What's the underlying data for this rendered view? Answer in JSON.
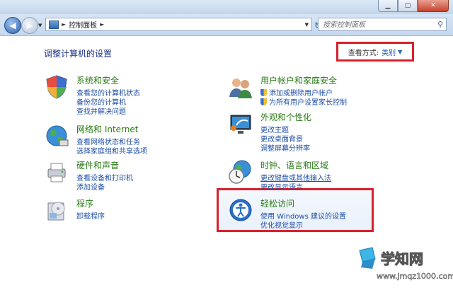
{
  "window": {
    "minimize_glyph": "▁",
    "maximize_glyph": "▢",
    "close_glyph": "✕"
  },
  "address": {
    "crumb": "控制面板",
    "separator": "►",
    "dropdown_glyph": "▼"
  },
  "search": {
    "placeholder": "搜索控制面板",
    "icon": "search-icon"
  },
  "page": {
    "title": "调整计算机的设置",
    "view_by_label": "查看方式:",
    "view_by_value": "类别",
    "view_by_arrow": "▼"
  },
  "categories": [
    {
      "title": "系统和安全",
      "icon": "shield-icon",
      "links": [
        "查看您的计算机状态",
        "备份您的计算机",
        "查找并解决问题"
      ]
    },
    {
      "title": "网络和 Internet",
      "icon": "network-globe-icon",
      "links": [
        "查看网络状态和任务",
        "选择家庭组和共享选项"
      ]
    },
    {
      "title": "硬件和声音",
      "icon": "printer-icon",
      "links": [
        "查看设备和打印机",
        "添加设备"
      ]
    },
    {
      "title": "程序",
      "icon": "programs-icon",
      "links": [
        "卸载程序"
      ]
    },
    {
      "title": "用户帐户和家庭安全",
      "icon": "users-icon",
      "links": [
        "添加或删除用户帐户",
        "为所有用户设置家长控制"
      ]
    },
    {
      "title": "外观和个性化",
      "icon": "monitor-icon",
      "links": [
        "更改主题",
        "更改桌面背景",
        "调整屏幕分辨率"
      ]
    },
    {
      "title": "时钟、语言和区域",
      "icon": "clock-globe-icon",
      "links": [
        "更改键盘或其他输入法",
        "更改显示语言"
      ]
    },
    {
      "title": "轻松访问",
      "icon": "ease-of-access-icon",
      "links": [
        "使用 Windows 建议的设置",
        "优化视觉显示"
      ]
    }
  ],
  "watermark": {
    "title": "学知网",
    "url": "www.jmqz1000.com"
  },
  "colors": {
    "highlight": "#d9202c",
    "category_title": "#2a7b16",
    "link": "#1f4fa8"
  }
}
